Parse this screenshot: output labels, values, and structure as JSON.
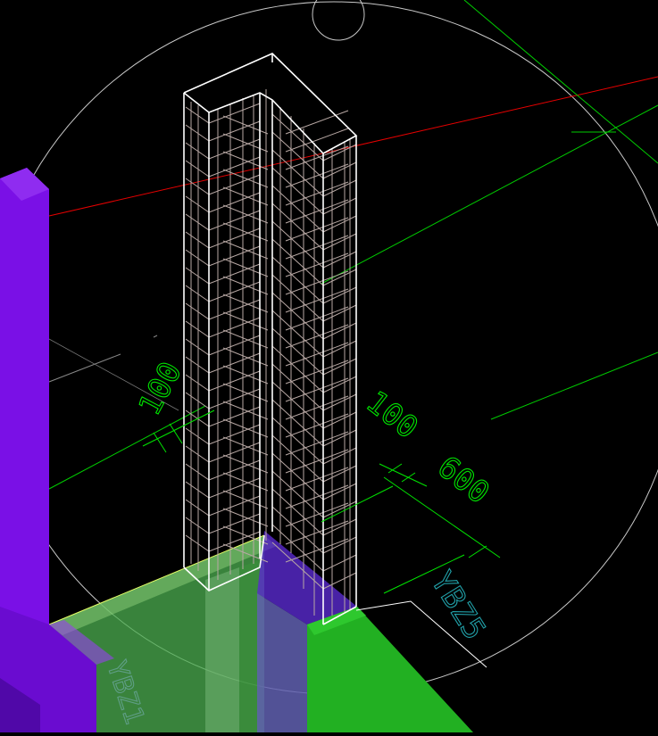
{
  "viewport": {
    "background": "#000000",
    "colors": {
      "column_edge": "#ffffff",
      "rebar": "#b8a8a4",
      "dimension": "#00e600",
      "axis_red": "#e60000",
      "axis_green": "#00cc00",
      "orbit": "#c8c8c8",
      "label_cyan": "#21a0a8",
      "slab_green": "#4caf50",
      "wall_purple": "#7a10e6",
      "beam_green": "#22b022",
      "beam_blue": "#6060b0"
    },
    "dimensions": {
      "left_dim": "100",
      "right_dim_top": "100",
      "right_dim_bottom": "600"
    },
    "labels": {
      "column_tag": "YBZ5",
      "wall_tag": "YBZ1"
    }
  }
}
